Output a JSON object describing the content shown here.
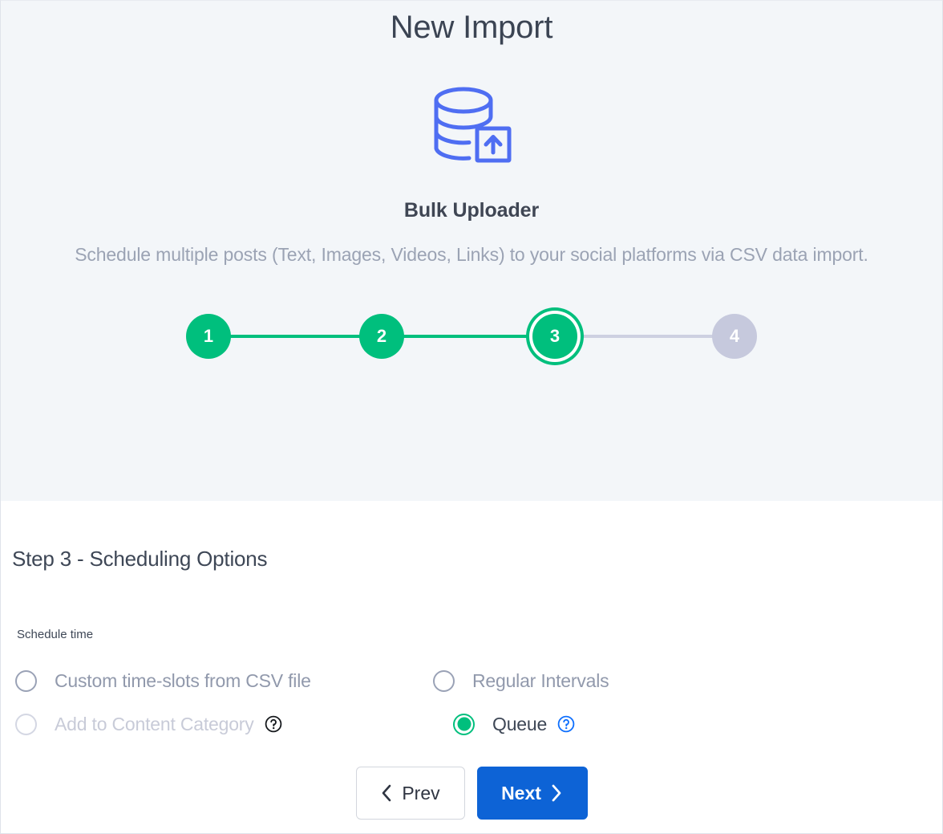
{
  "modal": {
    "title": "New Import"
  },
  "hero": {
    "icon": "database-upload-icon",
    "icon_color": "#4f6ef2",
    "heading": "Bulk Uploader",
    "subtitle": "Schedule multiple posts (Text, Images, Videos, Links) to your social platforms via CSV data import."
  },
  "stepper": {
    "active_step": 3,
    "done_color": "#00bf7d",
    "upcoming_color": "#c6c9dd",
    "steps": [
      {
        "label": "1",
        "state": "done"
      },
      {
        "label": "2",
        "state": "done"
      },
      {
        "label": "3",
        "state": "current"
      },
      {
        "label": "4",
        "state": "upcoming"
      }
    ]
  },
  "body": {
    "step_title": "Step 3 - Scheduling Options",
    "field_label": "Schedule time",
    "options": [
      {
        "id": "custom-time-slots",
        "label": "Custom time-slots from CSV file",
        "checked": false,
        "disabled": false,
        "help": false
      },
      {
        "id": "regular-intervals",
        "label": "Regular Intervals",
        "checked": false,
        "disabled": false,
        "help": false
      },
      {
        "id": "add-to-content-category",
        "label": "Add to Content Category",
        "checked": false,
        "disabled": true,
        "help": true,
        "help_icon": "help-circle-icon",
        "help_color": "#16191d"
      },
      {
        "id": "queue",
        "label": "Queue",
        "checked": true,
        "disabled": false,
        "help": true,
        "help_icon": "help-circle-icon",
        "help_color": "#0d6efd"
      }
    ]
  },
  "footer": {
    "prev_label": "Prev",
    "next_label": "Next",
    "prev_icon": "chevron-left-icon",
    "next_icon": "chevron-right-icon",
    "next_color": "#0d63d6"
  }
}
